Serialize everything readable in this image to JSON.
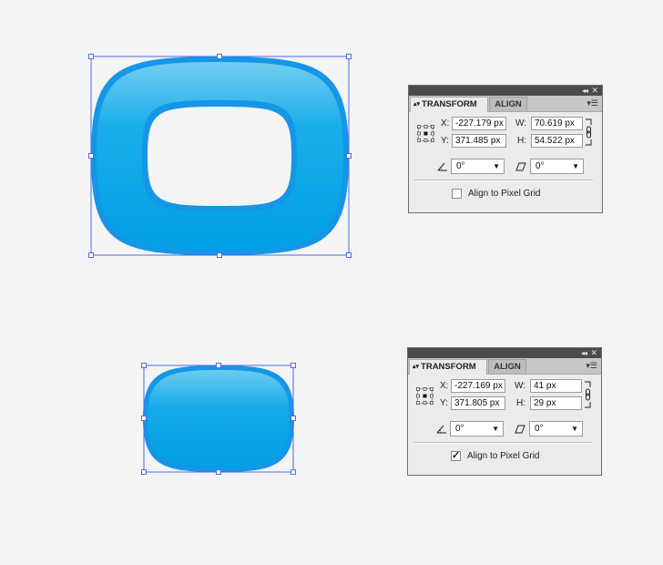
{
  "artboard": {
    "shape_color": "#07a2e6",
    "shape_highlight": "#7ecff3",
    "selection_color": "#4c6ce4"
  },
  "panels": [
    {
      "tabs": {
        "active": "TRANSFORM",
        "inactive": "ALIGN"
      },
      "x_label": "X:",
      "x_value": "-227.179 px",
      "y_label": "Y:",
      "y_value": "371.485 px",
      "w_label": "W:",
      "w_value": "70.619 px",
      "h_label": "H:",
      "h_value": "54.522 px",
      "rotate_value": "0°",
      "shear_value": "0°",
      "align_pixel_label": "Align to Pixel Grid",
      "align_pixel_checked": false
    },
    {
      "tabs": {
        "active": "TRANSFORM",
        "inactive": "ALIGN"
      },
      "x_label": "X:",
      "x_value": "-227.169 px",
      "y_label": "Y:",
      "y_value": "371.805 px",
      "w_label": "W:",
      "w_value": "41 px",
      "h_label": "H:",
      "h_value": "29 px",
      "rotate_value": "0°",
      "shear_value": "0°",
      "align_pixel_label": "Align to Pixel Grid",
      "align_pixel_checked": true
    }
  ]
}
